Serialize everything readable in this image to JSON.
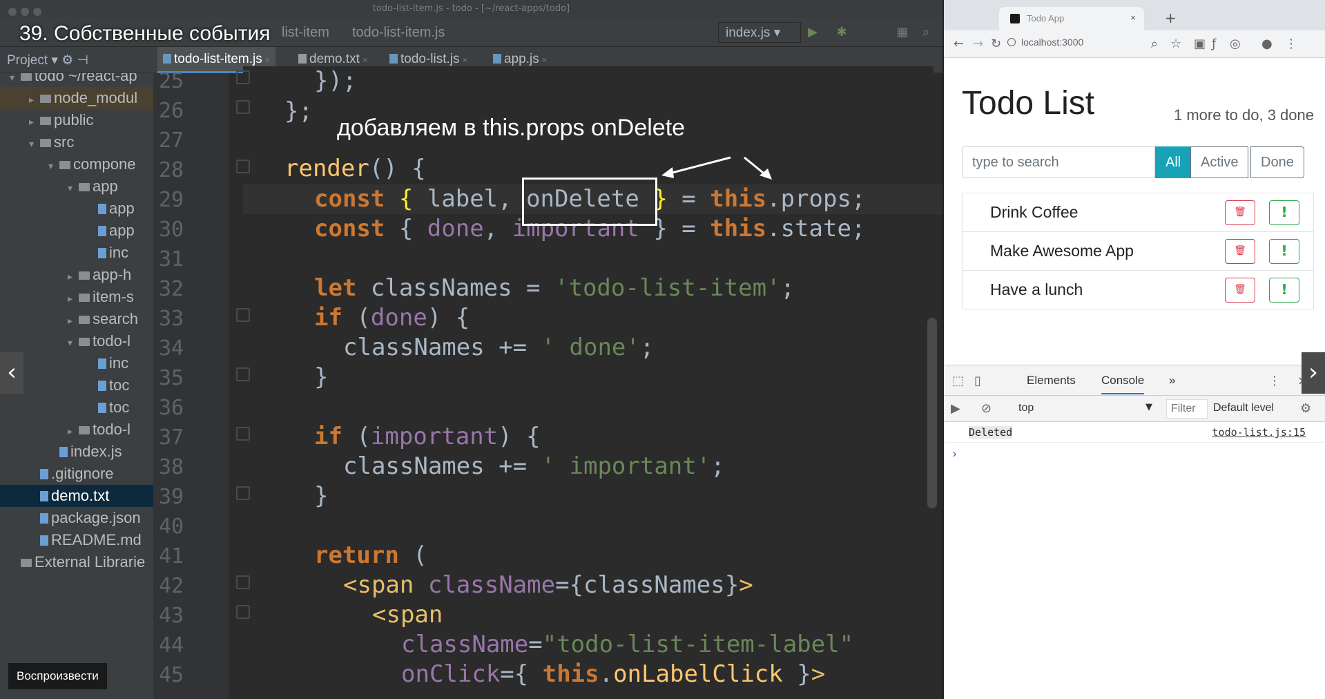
{
  "lesson": {
    "title": "39. Собственные события",
    "play_label": "Воспроизвести"
  },
  "ide": {
    "window_title": "todo-list-item.js - todo - [~/react-apps/todo]",
    "breadcrumbs": [
      "list-item",
      "todo-list-item.js"
    ],
    "run_config": "index.js",
    "project_label": "Project",
    "tabs": [
      {
        "label": "todo-list-item.js",
        "active": true
      },
      {
        "label": "demo.txt",
        "active": false
      },
      {
        "label": "todo-list.js",
        "active": false
      },
      {
        "label": "app.js",
        "active": false
      }
    ],
    "tree": [
      {
        "label": "todo ~/react-ap",
        "arrow": "▾",
        "kind": "folder",
        "indent": 0
      },
      {
        "label": "node_modul",
        "arrow": "▸",
        "kind": "folder",
        "indent": 1
      },
      {
        "label": "public",
        "arrow": "▸",
        "kind": "folder",
        "indent": 1
      },
      {
        "label": "src",
        "arrow": "▾",
        "kind": "folder",
        "indent": 1
      },
      {
        "label": "compone",
        "arrow": "▾",
        "kind": "folder",
        "indent": 2
      },
      {
        "label": "app",
        "arrow": "▾",
        "kind": "folder",
        "indent": 3
      },
      {
        "label": "app",
        "arrow": "",
        "kind": "file",
        "indent": 4
      },
      {
        "label": "app",
        "arrow": "",
        "kind": "file",
        "indent": 4
      },
      {
        "label": "inc",
        "arrow": "",
        "kind": "file",
        "indent": 4
      },
      {
        "label": "app-h",
        "arrow": "▸",
        "kind": "folder",
        "indent": 3
      },
      {
        "label": "item-s",
        "arrow": "▸",
        "kind": "folder",
        "indent": 3
      },
      {
        "label": "search",
        "arrow": "▸",
        "kind": "folder",
        "indent": 3
      },
      {
        "label": "todo-l",
        "arrow": "▾",
        "kind": "folder",
        "indent": 3
      },
      {
        "label": "inc",
        "arrow": "",
        "kind": "file",
        "indent": 4
      },
      {
        "label": "toc",
        "arrow": "",
        "kind": "file",
        "indent": 4
      },
      {
        "label": "toc",
        "arrow": "",
        "kind": "file",
        "indent": 4
      },
      {
        "label": "todo-l",
        "arrow": "▸",
        "kind": "folder",
        "indent": 3
      },
      {
        "label": "index.js",
        "arrow": "",
        "kind": "file",
        "indent": 2
      },
      {
        "label": ".gitignore",
        "arrow": "",
        "kind": "file",
        "indent": 1
      },
      {
        "label": "demo.txt",
        "arrow": "",
        "kind": "file",
        "indent": 1
      },
      {
        "label": "package.json",
        "arrow": "",
        "kind": "file",
        "indent": 1
      },
      {
        "label": "README.md",
        "arrow": "",
        "kind": "file",
        "indent": 1
      },
      {
        "label": "External Librarie",
        "arrow": "",
        "kind": "folder",
        "indent": 0
      }
    ],
    "line_numbers": [
      "25",
      "26",
      "27",
      "28",
      "29",
      "30",
      "31",
      "32",
      "33",
      "34",
      "35",
      "36",
      "37",
      "38",
      "39",
      "40",
      "41",
      "42",
      "43",
      "44",
      "45"
    ],
    "annotation": "добавляем в this.props onDelete"
  },
  "browser": {
    "tab_title": "Todo App",
    "url": "localhost:3000",
    "app": {
      "title": "Todo List",
      "status": "1 more to do, 3 done",
      "search_placeholder": "type to search",
      "filters": [
        {
          "label": "All",
          "active": true
        },
        {
          "label": "Active",
          "active": false
        },
        {
          "label": "Done",
          "active": false
        }
      ],
      "items": [
        {
          "label": "Drink Coffee"
        },
        {
          "label": "Make Awesome App"
        },
        {
          "label": "Have a lunch"
        }
      ],
      "delete_icon": "trash-icon",
      "important_label": "!"
    },
    "devtools": {
      "tabs": [
        "Elements",
        "Console"
      ],
      "active_tab": "Console",
      "more": "»",
      "context": "top",
      "filter_placeholder": "Filter",
      "level": "Default level",
      "log_message": "Deleted",
      "log_source": "todo-list.js:15",
      "prompt": "›"
    }
  }
}
